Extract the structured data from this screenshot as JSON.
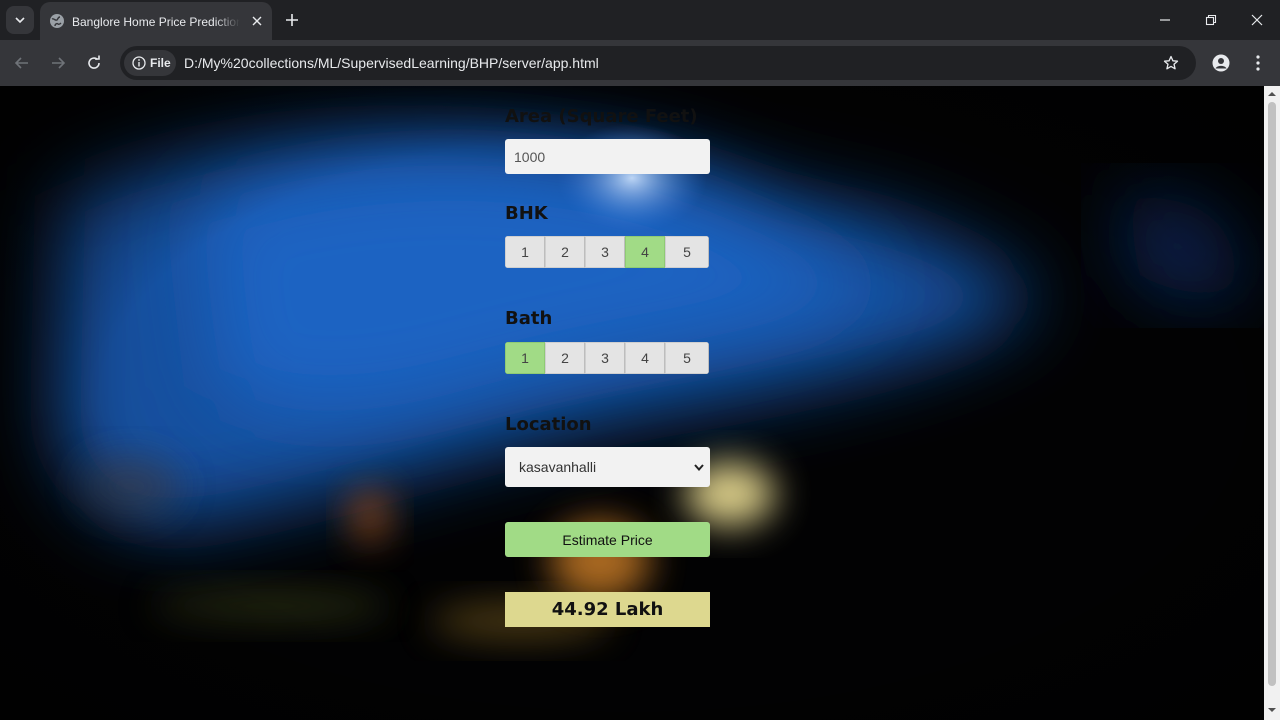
{
  "browser": {
    "tab": {
      "title": "Banglore Home Price Prediction"
    },
    "address_bar": {
      "chip_label": "File",
      "url": "D:/My%20collections/ML/SupervisedLearning/BHP/server/app.html"
    }
  },
  "form": {
    "area": {
      "label": "Area (Square Feet)",
      "value": "1000"
    },
    "bhk": {
      "label": "BHK",
      "options": [
        "1",
        "2",
        "3",
        "4",
        "5"
      ],
      "selected": "4"
    },
    "bath": {
      "label": "Bath",
      "options": [
        "1",
        "2",
        "3",
        "4",
        "5"
      ],
      "selected": "1"
    },
    "location": {
      "label": "Location",
      "selected": "kasavanhalli"
    },
    "estimate_button": "Estimate Price",
    "result": "44.92 Lakh"
  },
  "colors": {
    "selected_option": "#a1db86",
    "button": "#a1db86",
    "result_background": "#ddd88f"
  }
}
